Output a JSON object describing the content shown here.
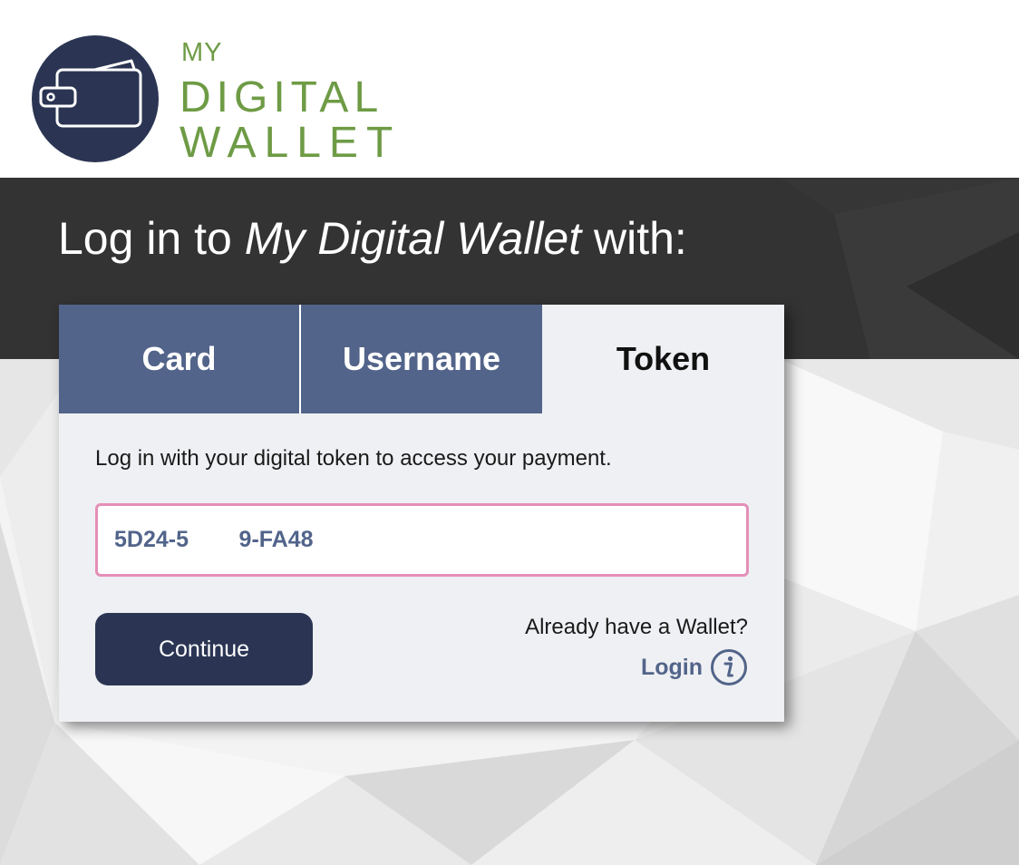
{
  "brand": {
    "logo_line1": "MY",
    "logo_line2": "DIGITAL",
    "logo_line3": "WALLET",
    "logo_icon": "wallet-icon",
    "circle_color": "#2b3553",
    "text_color": "#6e9b45"
  },
  "hero": {
    "title_prefix": "Log in to ",
    "title_emphasis": "My Digital Wallet",
    "title_suffix": " with:"
  },
  "tabs": [
    {
      "label": "Card",
      "active": false
    },
    {
      "label": "Username",
      "active": false
    },
    {
      "label": "Token",
      "active": true
    }
  ],
  "form": {
    "description": "Log in with your digital token to access your payment.",
    "token_value": "5D24-5        9-FA48",
    "continue_label": "Continue",
    "already_text": "Already have a Wallet?",
    "login_label": "Login",
    "info_icon": "info-icon"
  },
  "colors": {
    "tab_inactive": "#52648a",
    "button": "#2b3553",
    "input_border": "#e48fb8",
    "band": "#333333"
  }
}
